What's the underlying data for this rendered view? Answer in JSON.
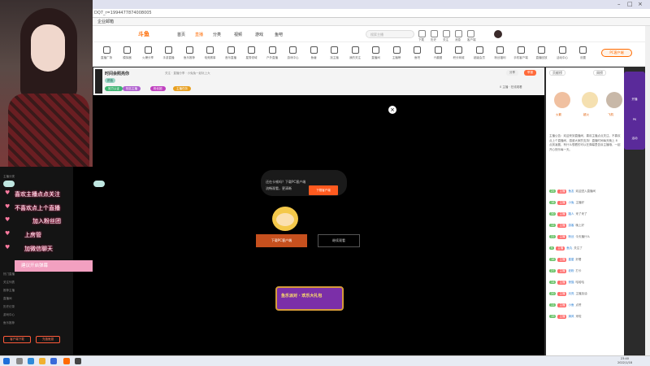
{
  "browser": {
    "address": "DQ7_r=1994477874008005",
    "bookmark": "企业邮箱"
  },
  "site": {
    "logo": "斗鱼",
    "nav": [
      "首页",
      "直播",
      "分类",
      "视频",
      "游戏",
      "鱼吧"
    ],
    "search_placeholder": "搜索主播",
    "header_icons": [
      "下载",
      "历史",
      "关注",
      "消息",
      "客户端"
    ]
  },
  "categories": [
    "直播广场",
    "模拟器",
    "火爆分享",
    "手游直播",
    "鱼乐推荐",
    "电竞赛事",
    "音乐直播",
    "星秀领域",
    "户外直播",
    "游戏中心",
    "鱼塘",
    "找主播",
    "我的关注",
    "直播间",
    "主播榜",
    "鱼吧",
    "兴趣圈",
    "积分商城",
    "超级会员",
    "粉丝福利",
    "手机客户端",
    "直播回放",
    "活动中心",
    "设置"
  ],
  "pc_button": "PC客户端",
  "room": {
    "title": "时间会照亮你",
    "sub": "关注 · 直播分享 · 小兔兔一起玩上大",
    "tag": "颜值",
    "badges": [
      "官方认证",
      "知名主播",
      "粉丝团",
      "主播任务"
    ],
    "right_buttons": [
      "分享",
      "举报"
    ],
    "stats": "0 主播 · 在线观看"
  },
  "video": {
    "close": "×",
    "bubble_line1": "还在卡顿吗？下载PC客户端",
    "bubble_line2": "流畅观看，更清晰",
    "bubble_button": "下载客户端",
    "download_button": "下载PC客户端",
    "watch_button": "继续观看",
    "promo": "鱼乐派对 · 欢乐大礼包"
  },
  "sidebar": {
    "tabs": [
      "贡献榜",
      "周榜"
    ],
    "rank_names": [
      "火箭",
      "超火",
      "飞机"
    ],
    "notice": "主播公告：欢迎来到直播间，喜欢主播点点关注，不喜欢点上个直播间，感谢大家的支持！直播时间每天晚上 8 点到凌晨，有什么想看的可以在弹幕里告诉主播哦，一起开心快乐每一天。",
    "chat": [
      {
        "lv": "25",
        "fan": "主播",
        "name": "鱼友",
        "text": "欢迎进入直播间"
      },
      {
        "lv": "18",
        "fan": "主播",
        "name": "小兔",
        "text": "主播好"
      },
      {
        "lv": "30",
        "fan": "主播",
        "name": "路人",
        "text": "来了来了"
      },
      {
        "lv": "12",
        "fan": "主播",
        "name": "游客",
        "text": "晚上好"
      },
      {
        "lv": "22",
        "fan": "主播",
        "name": "粉丝",
        "text": "今天播什么"
      },
      {
        "lv": "9",
        "fan": "主播",
        "name": "鱼丸",
        "text": "关注了"
      },
      {
        "lv": "16",
        "fan": "主播",
        "name": "星星",
        "text": "好看"
      },
      {
        "lv": "27",
        "fan": "主播",
        "name": "老粉",
        "text": "打卡"
      },
      {
        "lv": "14",
        "fan": "主播",
        "name": "夜猫",
        "text": "哈哈哈"
      },
      {
        "lv": "20",
        "fan": "主播",
        "name": "月亮",
        "text": "主播加油"
      },
      {
        "lv": "11",
        "fan": "主播",
        "name": "小鱼",
        "text": "点赞"
      },
      {
        "lv": "19",
        "fan": "主播",
        "name": "清风",
        "text": "来啦"
      }
    ]
  },
  "purple_panel": [
    "开播",
    "PK",
    "活动"
  ],
  "overlay": {
    "stickers": [
      "喜欢主播点点关注",
      "不喜欢点上个直播",
      "加入粉丝团",
      "上房管",
      "加微信聊天"
    ],
    "sticker_last": "建议开启弹幕",
    "left_buttons": [
      "客户端下载",
      "充值鱼翅"
    ],
    "left_texts": [
      "主播分类",
      "热门直播",
      "关注列表",
      "推荐主播",
      "直播间",
      "历史记录",
      "游戏中心",
      "鱼乐推荐"
    ]
  },
  "taskbar": {
    "time": "23:40",
    "date": "2022/1/18"
  }
}
